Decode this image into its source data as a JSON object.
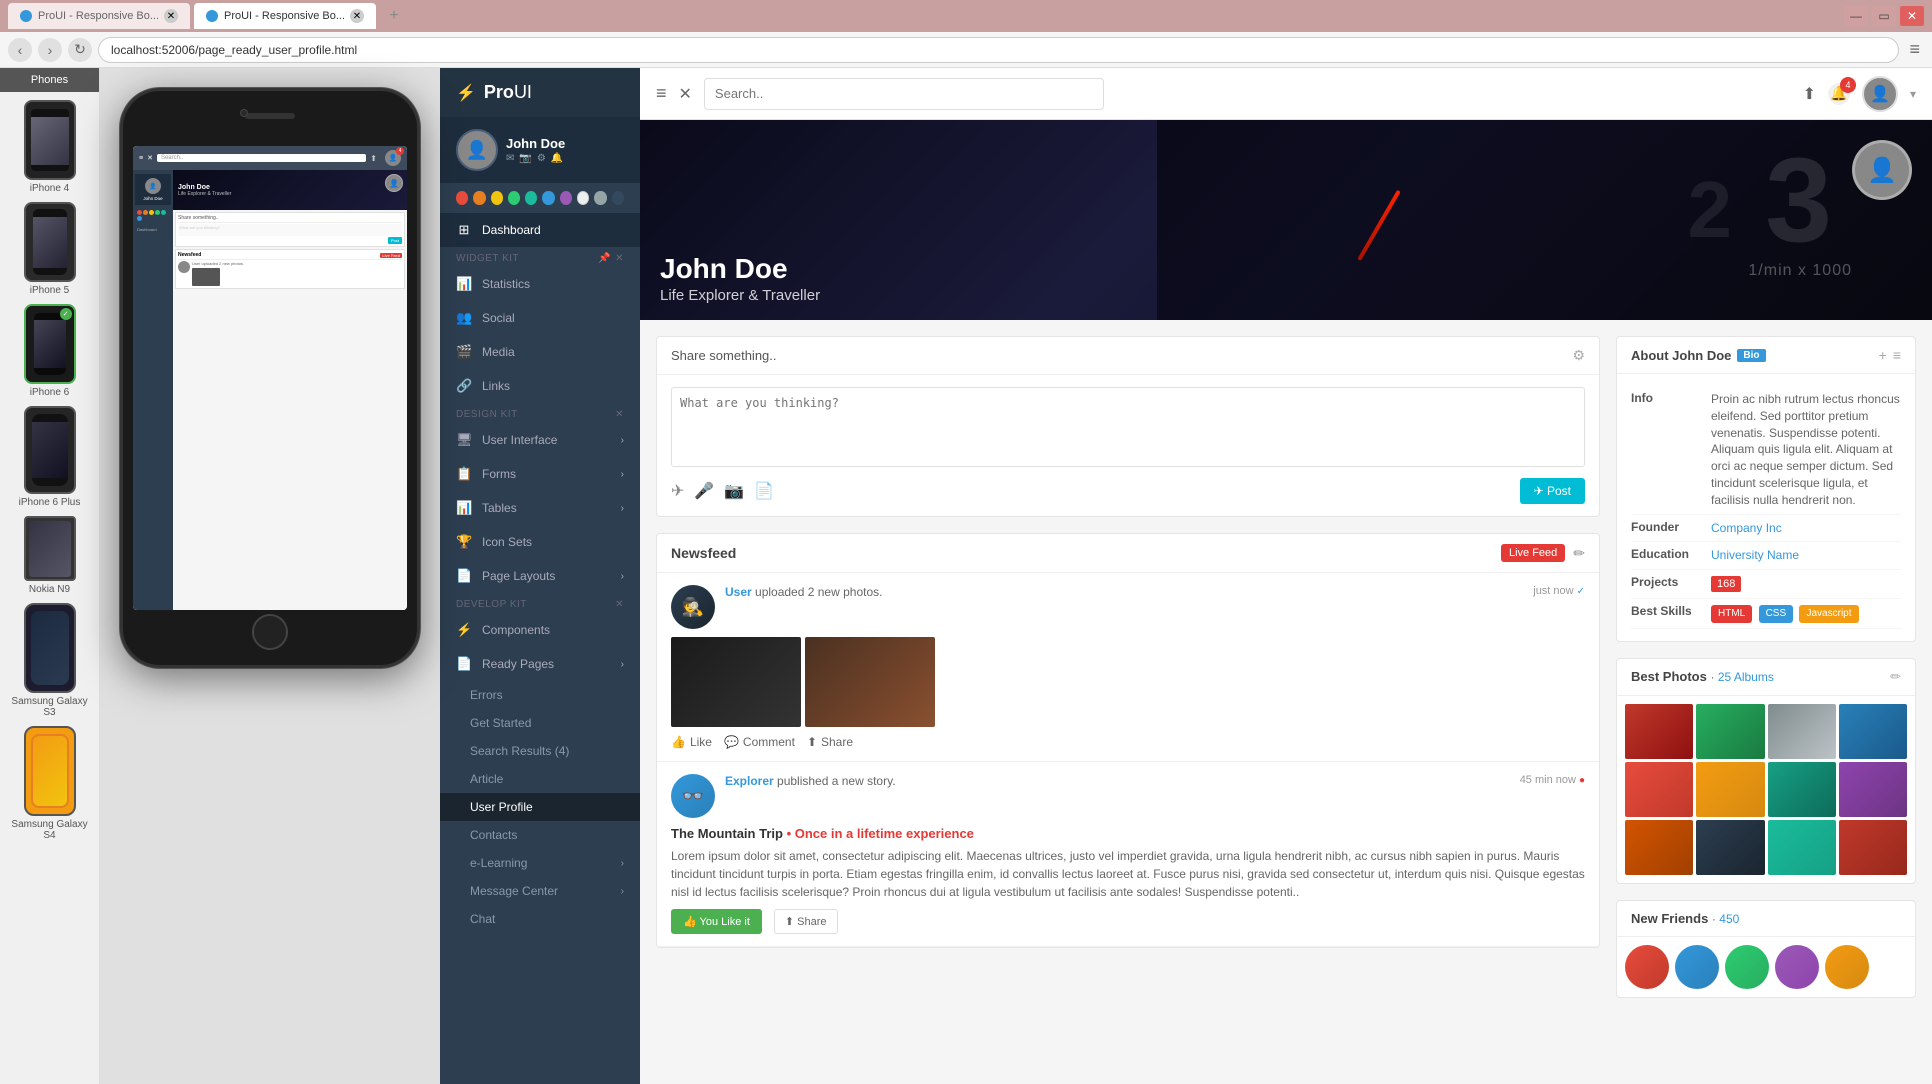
{
  "browser": {
    "tabs": [
      {
        "label": "ProUI - Responsive Bo...",
        "active": false
      },
      {
        "label": "ProUI - Responsive Bo...",
        "active": true
      }
    ],
    "new_tab": "+",
    "address": "localhost:52006/page_ready_user_profile.html",
    "window_controls": [
      "—",
      "▭",
      "✕"
    ]
  },
  "phone_panel": {
    "header": "Phones",
    "devices": [
      {
        "label": "iPhone 4",
        "key": "iphone4"
      },
      {
        "label": "iPhone 5",
        "key": "iphone5"
      },
      {
        "label": "iPhone 6",
        "key": "iphone6",
        "active": true
      },
      {
        "label": "iPhone 6 Plus",
        "key": "iphone6plus"
      },
      {
        "label": "Nokia N9",
        "key": "nokian9"
      },
      {
        "label": "Samsung Galaxy S3",
        "key": "galaxys3"
      },
      {
        "label": "Samsung Galaxy S4",
        "key": "galaxys4"
      }
    ]
  },
  "mini_app": {
    "header": "Search..",
    "user": "John Doe",
    "subtitle": "Life Explorer & Traveller",
    "share_placeholder": "What are you thinking?",
    "post_btn": "Post",
    "newsfeed_label": "Newsfeed",
    "live_feed": "Live Feed",
    "uploaded_text": "User uploaded 2 new photos."
  },
  "sidebar": {
    "brand": "ProUI",
    "brand_pro": "Pro",
    "brand_ui": "UI",
    "username": "John Doe",
    "user_icons": [
      "✉",
      "📷",
      "⚙",
      "🔔"
    ],
    "circles": [
      "#e74c3c",
      "#e67e22",
      "#f1c40f",
      "#2ecc71",
      "#1abc9c",
      "#3498db",
      "#9b59b6",
      "#ecf0f1",
      "#95a5a6",
      "#34495e"
    ],
    "nav": {
      "dashboard_label": "Dashboard",
      "widget_kit_label": "WIDGET KIT",
      "items_widget": [
        {
          "label": "Statistics",
          "icon": "📊"
        },
        {
          "label": "Social",
          "icon": "👥"
        },
        {
          "label": "Media",
          "icon": "🎬"
        },
        {
          "label": "Links",
          "icon": "🔗"
        }
      ],
      "design_kit_label": "DESIGN KIT",
      "items_design": [
        {
          "label": "User Interface",
          "icon": "🖥",
          "arrow": true
        },
        {
          "label": "Forms",
          "icon": "📋",
          "arrow": true
        },
        {
          "label": "Tables",
          "icon": "📊",
          "arrow": true
        },
        {
          "label": "Icon Sets",
          "icon": "🏆",
          "arrow": false
        },
        {
          "label": "Page Layouts",
          "icon": "📄",
          "arrow": true
        }
      ],
      "develop_kit_label": "DEVELOP KIT",
      "items_develop": [
        {
          "label": "Components",
          "icon": "⚡",
          "arrow": false
        },
        {
          "label": "Ready Pages",
          "icon": "📄",
          "arrow": true
        }
      ],
      "sub_items": [
        {
          "label": "Errors"
        },
        {
          "label": "Get Started"
        },
        {
          "label": "Search Results (4)"
        },
        {
          "label": "Article"
        },
        {
          "label": "User Profile",
          "active": true
        },
        {
          "label": "Contacts"
        },
        {
          "label": "e-Learning",
          "arrow": true
        },
        {
          "label": "Message Center",
          "arrow": true
        },
        {
          "label": "Chat"
        }
      ]
    }
  },
  "topbar": {
    "search_placeholder": "Search..",
    "badge_count": "4",
    "avatar_alt": "User"
  },
  "profile": {
    "name": "John Doe",
    "title": "Life Explorer & Traveller",
    "banner_clock": "3",
    "banner_text": "1/min x 1000"
  },
  "share_box": {
    "header": "Share something..",
    "placeholder": "What are you thinking?",
    "post_btn": "✈ Post",
    "icons": [
      "✈",
      "🎤",
      "📷",
      "📄"
    ]
  },
  "newsfeed": {
    "title": "Newsfeed",
    "live_badge": "Live Feed",
    "items": [
      {
        "user": "User",
        "action": " uploaded 2 new photos.",
        "time": "just now",
        "type": "photos",
        "like": "Like",
        "comment": "Comment",
        "share": "Share"
      },
      {
        "user": "Explorer",
        "action": " published a new story.",
        "time": "45 min now",
        "type": "story",
        "story_title": "The Mountain Trip",
        "story_accent": " • Once in a lifetime experience",
        "story_body": "Lorem ipsum dolor sit amet, consectetur adipiscing elit. Maecenas ultrices, justo vel imperdiet gravida, urna ligula hendrerit nibh, ac cursus nibh sapien in purus. Mauris tincidunt tincidunt turpis in porta. Etiam egestas fringilla enim, id convallis lectus laoreet at. Fusce purus nisi, gravida sed consectetur ut, interdum quis nisi. Quisque egestas nisl id lectus facilisis scelerisque? Proin rhoncus dui at ligula vestibulum ut facilisis ante sodales! Suspendisse potenti..",
        "you_like": "👍 You Like it",
        "share": "Share"
      }
    ]
  },
  "about": {
    "title": "About John Doe",
    "bio_badge": "Bio",
    "info": {
      "info_label": "Info",
      "info_value": "Proin ac nibh rutrum lectus rhoncus eleifend. Sed porttitor pretium venenatis. Suspendisse potenti. Aliquam quis ligula elit. Aliquam at orci ac neque semper dictum. Sed tincidunt scelerisque ligula, et facilisis nulla hendrerit non.",
      "founder_label": "Founder",
      "founder_value": "Company Inc",
      "education_label": "Education",
      "education_value": "University Name",
      "projects_label": "Projects",
      "projects_count": "168",
      "skills_label": "Best Skills",
      "skills": [
        "HTML",
        "CSS",
        "Javascript"
      ]
    }
  },
  "best_photos": {
    "title": "Best Photos",
    "dot": "•",
    "albums_count": "25 Albums"
  },
  "new_friends": {
    "title": "New Friends",
    "dot": "•",
    "count": "450"
  }
}
